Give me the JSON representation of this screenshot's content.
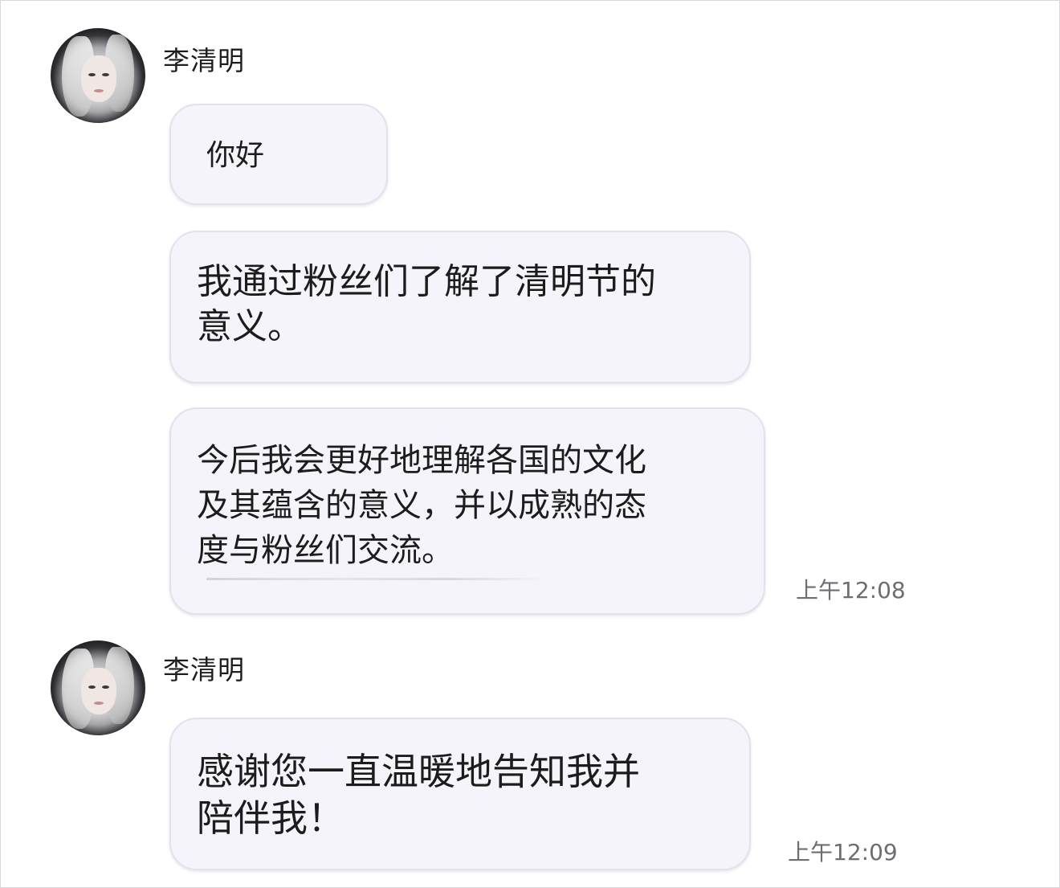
{
  "chat": {
    "group1": {
      "sender": "李清明",
      "messages": [
        {
          "text": "你好"
        },
        {
          "text": "我通过粉丝们了解了清明节的\n意义。"
        },
        {
          "text": "今后我会更好地理解各国的文化\n及其蕴含的意义，并以成熟的态\n度与粉丝们交流。"
        }
      ],
      "timestamp": "上午12:08"
    },
    "group2": {
      "sender": "李清明",
      "messages": [
        {
          "text": "感谢您一直温暖地告知我并\n陪伴我！"
        }
      ],
      "timestamp": "上午12:09"
    }
  },
  "colors": {
    "bubble_bg": "#f5f4fb",
    "bubble_border": "#e3e1ee",
    "timestamp": "#6d6d72"
  },
  "icons": {
    "avatar": "profile-photo"
  }
}
